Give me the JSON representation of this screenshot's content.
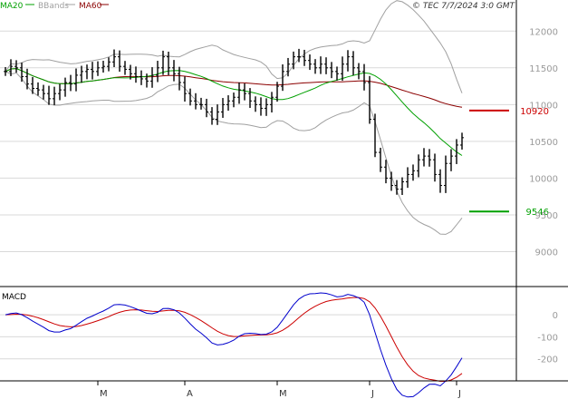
{
  "header": {
    "legend": [
      {
        "label": "MA20",
        "color": "#00a000"
      },
      {
        "label": "BBands",
        "color": "#a0a0a0"
      },
      {
        "label": "MA60",
        "color": "#8b0000"
      }
    ],
    "copyright": "© TEC 7/7/2024 3:0 GMT"
  },
  "colors": {
    "price": "#000000",
    "ma20": "#00a000",
    "bbands": "#a0a0a0",
    "ma60": "#8b0000",
    "macd": "#0000cc",
    "signal": "#cc0000",
    "grid": "#d9d9d9",
    "axis_text": "#9a9a9a",
    "resistance": "#cc0000",
    "support": "#00a000"
  },
  "chart_data": [
    {
      "type": "ohlc",
      "y_ticks": [
        12000,
        11500,
        11000,
        10500,
        10000,
        9500,
        9000
      ],
      "y_tick_labels": [
        "12000",
        "11500",
        "11000",
        "10500",
        "10000",
        "9500",
        "9000"
      ],
      "ylim": [
        8550,
        12250
      ],
      "x_ticks": [
        {
          "label": "M",
          "index": 17
        },
        {
          "label": "A",
          "index": 33
        },
        {
          "label": "M",
          "index": 50
        },
        {
          "label": "J",
          "index": 67
        },
        {
          "label": "J",
          "index": 83
        }
      ],
      "levels": [
        {
          "name": "resistance",
          "value": 10920,
          "label": "10920",
          "color": "#cc0000"
        },
        {
          "name": "support",
          "value": 9546,
          "label": "9546",
          "color": "#00a000"
        }
      ],
      "close": [
        11450,
        11520,
        11500,
        11380,
        11280,
        11220,
        11200,
        11150,
        11080,
        11150,
        11200,
        11300,
        11280,
        11400,
        11450,
        11480,
        11450,
        11500,
        11520,
        11580,
        11650,
        11520,
        11480,
        11420,
        11380,
        11350,
        11320,
        11400,
        11500,
        11650,
        11500,
        11420,
        11300,
        11150,
        11050,
        11000,
        11000,
        10900,
        10800,
        10900,
        11000,
        11050,
        11100,
        11200,
        11150,
        11050,
        11000,
        10950,
        11000,
        11100,
        11250,
        11450,
        11550,
        11650,
        11650,
        11600,
        11550,
        11500,
        11550,
        11500,
        11450,
        11420,
        11550,
        11650,
        11500,
        11450,
        11300,
        10800,
        10350,
        10150,
        10000,
        9900,
        9850,
        9950,
        10050,
        10100,
        10250,
        10300,
        10250,
        10050,
        9900,
        10200,
        10300,
        10450,
        10550
      ]
    },
    {
      "type": "line",
      "title": "MACD",
      "y_ticks": [
        0,
        -100,
        -200
      ],
      "y_tick_labels": [
        "0",
        "-100",
        "-200"
      ],
      "ylim": [
        -300,
        120
      ]
    }
  ]
}
